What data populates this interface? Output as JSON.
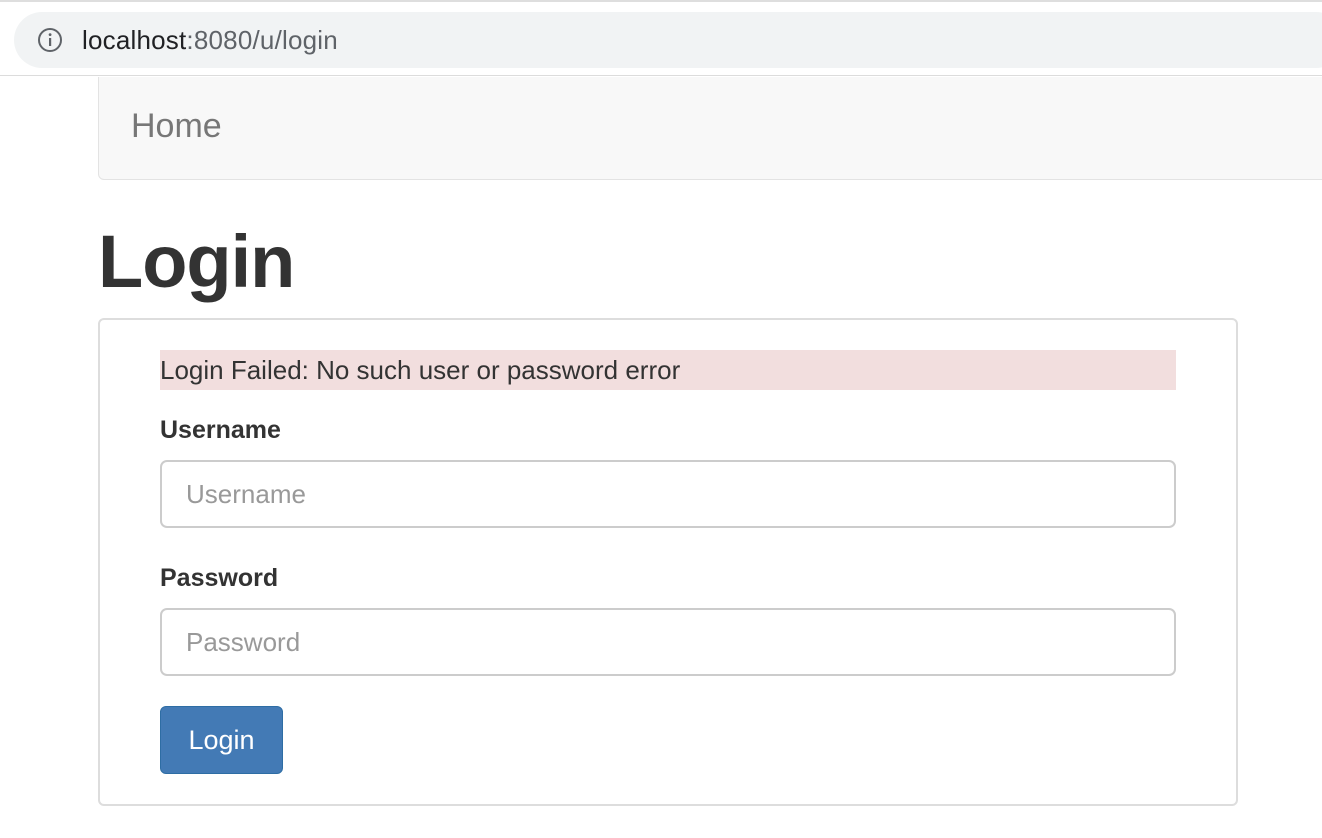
{
  "browser": {
    "url_host": "localhost",
    "url_path": ":8080/u/login",
    "info_icon": "info-circle-icon"
  },
  "navbar": {
    "brand": "Home"
  },
  "page": {
    "title": "Login"
  },
  "login_form": {
    "error_message": "Login Failed: No such user or password error",
    "username_label": "Username",
    "username_placeholder": "Username",
    "username_value": "",
    "password_label": "Password",
    "password_placeholder": "Password",
    "password_value": "",
    "submit_label": "Login"
  },
  "colors": {
    "alert_background": "#f2dede",
    "button_primary": "#437ab5",
    "navbar_background": "#f8f8f8"
  }
}
